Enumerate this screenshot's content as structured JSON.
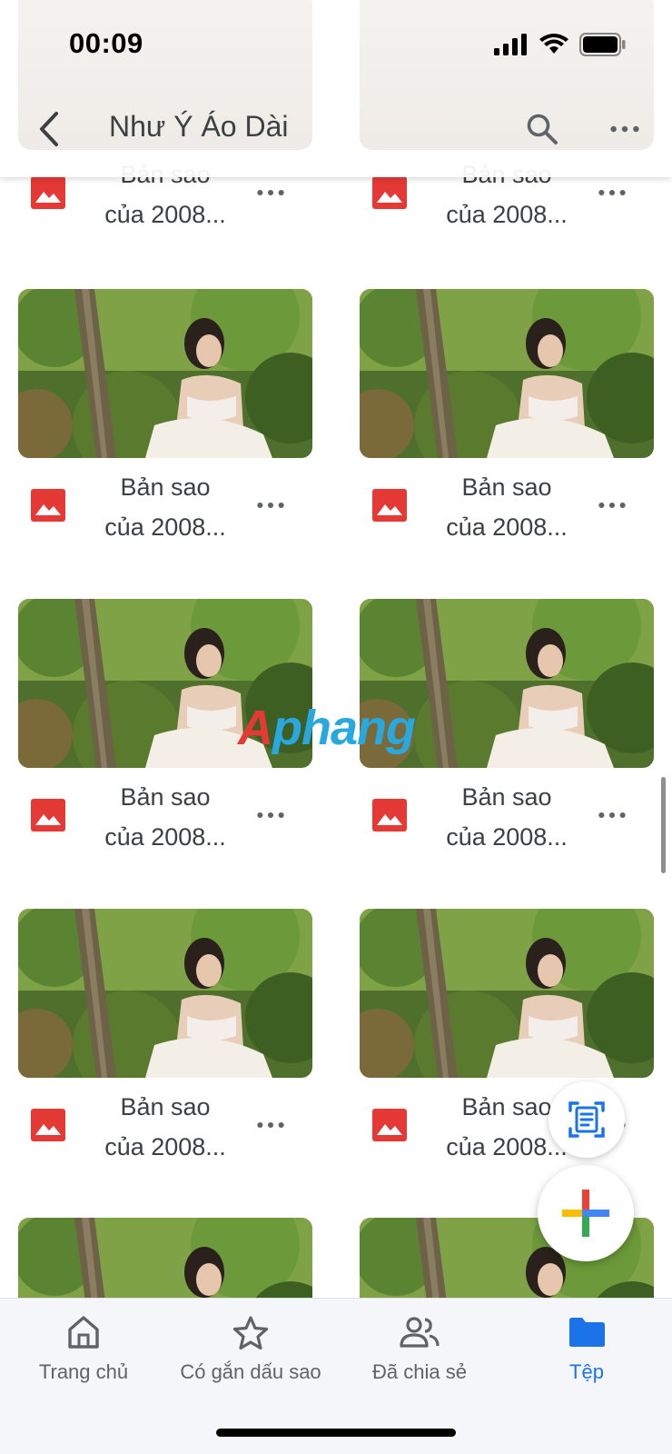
{
  "status_bar": {
    "time": "00:09",
    "signal_icon": "cellular-signal-icon",
    "wifi_icon": "wifi-icon",
    "battery_icon": "battery-icon"
  },
  "header": {
    "title": "Như Ý Áo Dài",
    "back_icon": "chevron-left-icon",
    "search_icon": "search-icon",
    "more_icon": "more-horizontal-icon"
  },
  "files": {
    "partial_top": [
      {
        "name": "Bản sao\ncủa 2008..."
      },
      {
        "name": "Bản sao\ncủa 2008..."
      }
    ],
    "items": [
      {
        "name": "Bản sao\ncủa 2008..."
      },
      {
        "name": "Bản sao\ncủa 2008..."
      },
      {
        "name": "Bản sao\ncủa 2008..."
      },
      {
        "name": "Bản sao\ncủa 2008..."
      },
      {
        "name": "Bản sao\ncủa 2008..."
      },
      {
        "name": "Bản sao\ncủa 2008..."
      }
    ],
    "file_type_icon": "image-file-icon",
    "more_icon": "more-horizontal-icon"
  },
  "watermark": {
    "first": "A",
    "rest": "phang"
  },
  "fabs": {
    "scan_icon": "document-scan-icon",
    "new_icon": "plus-icon"
  },
  "bottom_nav": {
    "items": [
      {
        "label": "Trang chủ",
        "icon": "home-icon",
        "active": false
      },
      {
        "label": "Có gắn dấu sao",
        "icon": "star-icon",
        "active": false
      },
      {
        "label": "Đã chia sẻ",
        "icon": "people-icon",
        "active": false
      },
      {
        "label": "Tệp",
        "icon": "folder-icon",
        "active": true
      }
    ]
  },
  "colors": {
    "accent": "#1a73e8",
    "image_icon": "#e53935",
    "text": "#3c4043"
  }
}
